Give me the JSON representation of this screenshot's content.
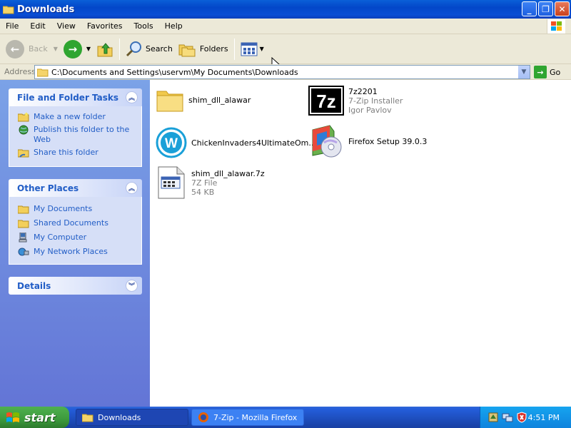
{
  "window": {
    "title": "Downloads"
  },
  "menu": [
    "File",
    "Edit",
    "View",
    "Favorites",
    "Tools",
    "Help"
  ],
  "toolbar": {
    "back": "Back",
    "search": "Search",
    "folders": "Folders"
  },
  "address": {
    "label": "Address",
    "value": "C:\\Documents and Settings\\uservm\\My Documents\\Downloads",
    "go": "Go"
  },
  "taskpane": {
    "file_tasks": {
      "title": "File and Folder Tasks",
      "items": [
        "Make a new folder",
        "Publish this folder to the Web",
        "Share this folder"
      ]
    },
    "other_places": {
      "title": "Other Places",
      "items": [
        "My Documents",
        "Shared Documents",
        "My Computer",
        "My Network Places"
      ]
    },
    "details": {
      "title": "Details"
    }
  },
  "files": [
    {
      "name": "shim_dll_alawar",
      "icon": "folder-icon"
    },
    {
      "name": "7z2201",
      "line2": "7-Zip Installer",
      "line3": "Igor Pavlov",
      "icon": "7zip-icon"
    },
    {
      "name": "ChickenInvaders4UltimateOm...",
      "icon": "wildtangent-icon"
    },
    {
      "name": "Firefox Setup 39.0.3",
      "icon": "installer-cd-icon"
    },
    {
      "name": "shim_dll_alawar.7z",
      "line2": "7Z File",
      "line3": "54 KB",
      "icon": "archive-file-icon"
    }
  ],
  "taskbar": {
    "start": "start",
    "items": [
      {
        "label": "Downloads"
      },
      {
        "label": "7-Zip - Mozilla Firefox"
      }
    ],
    "clock": "4:51 PM"
  }
}
